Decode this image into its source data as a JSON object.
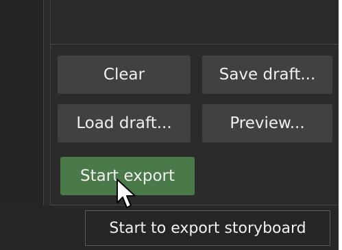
{
  "buttons": {
    "clear": "Clear",
    "save_draft": "Save draft...",
    "load_draft": "Load draft...",
    "preview": "Preview...",
    "start_export": "Start export"
  },
  "tooltip": {
    "text": "Start to export storyboard"
  },
  "icons": {
    "cursor": "mouse-pointer-icon"
  },
  "colors": {
    "background": "#262626",
    "button": "#414141",
    "primary_button": "#4b7a4a",
    "text": "#f0f0f0"
  }
}
